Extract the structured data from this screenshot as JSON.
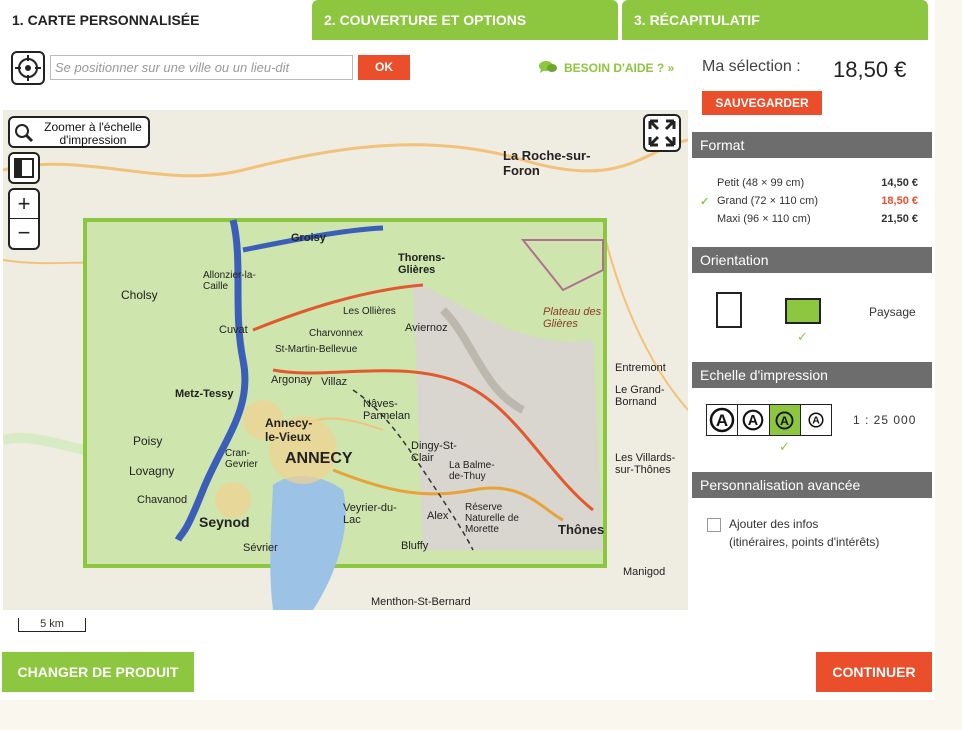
{
  "tabs": [
    {
      "label": "1. CARTE PERSONNALISÉE"
    },
    {
      "label": "2. COUVERTURE ET OPTIONS"
    },
    {
      "label": "3. RÉCAPITULATIF"
    }
  ],
  "search": {
    "placeholder": "Se positionner sur une ville ou un lieu-dit",
    "value": "",
    "ok_label": "OK"
  },
  "help": {
    "label": "BESOIN D'AIDE ? »"
  },
  "map": {
    "zoom_print_label": "Zoomer à l'échelle d'impression",
    "zoom_in": "+",
    "zoom_out": "−",
    "scale_label": "5 km",
    "places": [
      "ANNECY",
      "Annecy-le-Vieux",
      "Seynod",
      "Thônes",
      "Thorens-Glières",
      "Groisy",
      "Argonay",
      "Villaz",
      "Aviernoz",
      "Cuvat",
      "Nâves-Parmelan",
      "Dingy-St-Clair",
      "Alex",
      "Veyrier-du-Lac",
      "Bluffy",
      "La Balme-de-Thuy",
      "Metz-Tessy",
      "Cran-Gevrier",
      "Plateau des Glières",
      "La Roche-sur-Foron",
      "Allonzier-la-Caille",
      "Charvonnex",
      "Les Ollières",
      "St-Martin-Bellevue",
      "Réserve Naturelle de Morette",
      "Poisy",
      "Lovagny",
      "Chavanod",
      "Entremont",
      "Le Grand-Bornand",
      "Les Villards-sur-Thônes",
      "Manigod",
      "Menthon-St-Bernard",
      "Cholsy",
      "Sévrier"
    ]
  },
  "selection": {
    "label": "Ma sélection :",
    "price": "18,50 €",
    "save_label": "SAUVEGARDER"
  },
  "format": {
    "title": "Format",
    "options": [
      {
        "label": "Petit (48 × 99 cm)",
        "price": "14,50 €",
        "selected": false
      },
      {
        "label": "Grand (72 × 110 cm)",
        "price": "18,50 €",
        "selected": true
      },
      {
        "label": "Maxi (96 × 110 cm)",
        "price": "21,50 €",
        "selected": false
      }
    ]
  },
  "orientation": {
    "title": "Orientation",
    "selected_label": "Paysage"
  },
  "print_scale": {
    "title": "Echelle d'impression",
    "ratio": "1 : 25 000",
    "selected_index": 2
  },
  "advanced": {
    "title": "Personnalisation avancée",
    "line1": "Ajouter des infos",
    "line2": "(itinéraires, points d'intérêts)"
  },
  "footer": {
    "change_label": "CHANGER DE PRODUIT",
    "continue_label": "CONTINUER"
  },
  "colors": {
    "green": "#8dc63f",
    "orange": "#ea4e2a",
    "header_gray": "#6d6d6d"
  }
}
